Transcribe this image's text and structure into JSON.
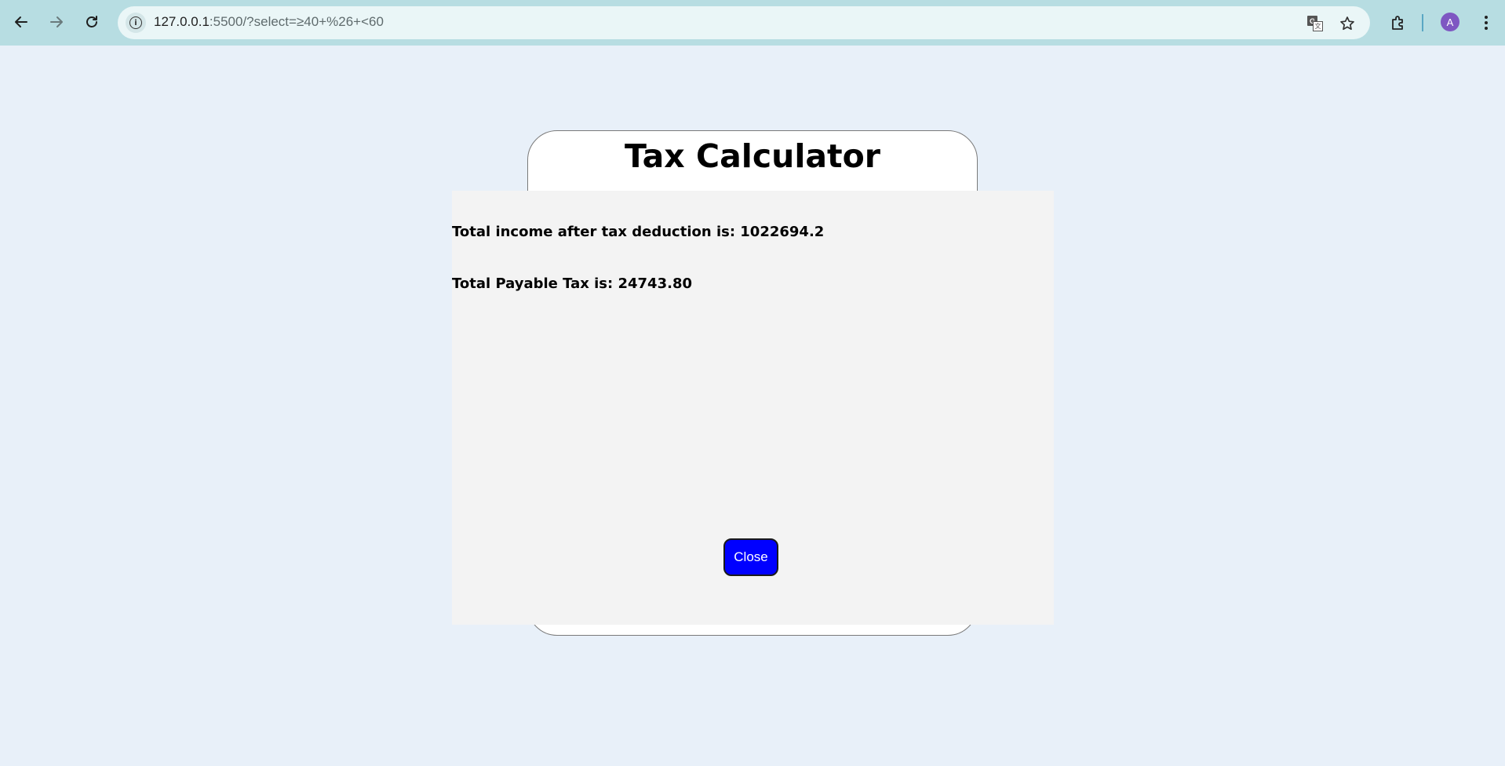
{
  "browser": {
    "url_host": "127.0.0.1",
    "url_path": ":5500/?select=≥40+%26+<60",
    "avatar_letter": "A",
    "icons": [
      "back-icon",
      "forward-icon",
      "reload-icon",
      "site-info-icon",
      "translate-icon",
      "bookmark-star-icon",
      "extensions-icon",
      "profile-avatar",
      "menu-icon"
    ]
  },
  "page": {
    "title": "Tax Calculator",
    "background_color": "#e8f0f9"
  },
  "modal": {
    "income_after_tax_text": "Total income after tax deduction is: 1022694.2",
    "payable_tax_text": "Total Payable Tax is: 24743.80",
    "close_label": "Close",
    "close_button_color": "#0000ff"
  }
}
